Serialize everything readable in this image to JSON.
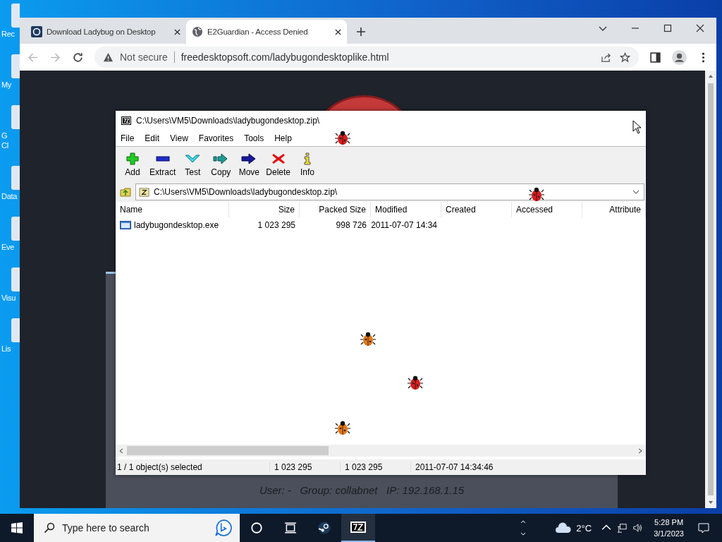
{
  "desktop_icons": [
    {
      "lines": [
        "Rec"
      ]
    },
    {
      "lines": [
        "My"
      ]
    },
    {
      "lines": [
        "G",
        "Cl"
      ]
    },
    {
      "lines": [
        "Data"
      ]
    },
    {
      "lines": [
        "Eve"
      ]
    },
    {
      "lines": [
        "Visu"
      ]
    },
    {
      "lines": [
        "Lis"
      ]
    }
  ],
  "browser": {
    "tabs": [
      {
        "title": "Download Ladybug on Desktop",
        "selected": false
      },
      {
        "title": "E2Guardian - Access Denied",
        "selected": true
      }
    ],
    "security": "Not secure",
    "url": "freedesktopsoft.com/ladybugondesktoplike.html",
    "page_footer": "User: -   Group: collabnet   IP: 192.168.1.15"
  },
  "archive_window": {
    "title": "C:\\Users\\VM5\\Downloads\\ladybugondesktop.zip\\",
    "menu": [
      "File",
      "Edit",
      "View",
      "Favorites",
      "Tools",
      "Help"
    ],
    "toolbar": [
      {
        "label": "Add",
        "kind": "add"
      },
      {
        "label": "Extract",
        "kind": "extract"
      },
      {
        "label": "Test",
        "kind": "test"
      },
      {
        "label": "Copy",
        "kind": "copy"
      },
      {
        "label": "Move",
        "kind": "move"
      },
      {
        "label": "Delete",
        "kind": "delete"
      },
      {
        "label": "Info",
        "kind": "info"
      }
    ],
    "path": "C:\\Users\\VM5\\Downloads\\ladybugondesktop.zip\\",
    "columns": [
      "Name",
      "Size",
      "Packed Size",
      "Modified",
      "Created",
      "Accessed",
      "Attribute"
    ],
    "rows": [
      {
        "cells": [
          "ladybugondesktop.exe",
          "1 023 295",
          "998 726",
          "2011-07-07 14:34",
          "",
          "",
          ""
        ],
        "selected": false
      }
    ],
    "status": [
      "1 / 1 object(s) selected",
      "1 023 295",
      "1 023 295",
      "2011-07-07 14:34:46"
    ]
  },
  "taskbar": {
    "search_placeholder": "Type here to search",
    "apps": [
      {
        "kind": "cortana",
        "active": false
      },
      {
        "kind": "taskview",
        "active": false
      },
      {
        "kind": "steam",
        "active": false
      },
      {
        "kind": "sevenzip",
        "active": true
      }
    ],
    "weather": "2°C",
    "time": "5:28 PM",
    "date": "3/1/2023"
  }
}
